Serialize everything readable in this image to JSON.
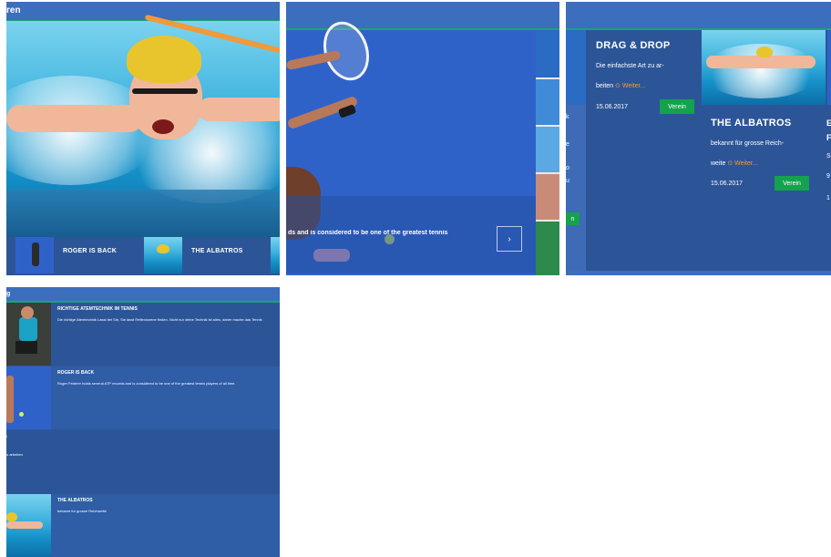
{
  "panel1": {
    "topbar_label": "ren",
    "strip": [
      {
        "label": "ROGER IS BACK"
      },
      {
        "label": "THE ALBATROS"
      }
    ]
  },
  "panel2": {
    "caption": "ds and is considered to be one of the greatest tennis",
    "next_icon": "chevron-right-icon"
  },
  "panel3": {
    "edge_letters": [
      "k",
      "e",
      "o",
      "u",
      "n"
    ],
    "edge_button_label": "n",
    "cards": [
      {
        "title": "DRAG & DROP",
        "text_line1": "Die einfachste Art zu ar-",
        "text_line2": "beiten",
        "more": "Weiter...",
        "date": "15.06.2017",
        "button": "Verein"
      },
      {
        "title": "THE ALBATROS",
        "text_line1": "bekannt für grosse Reich-",
        "text_line2": "weite",
        "more": "Weiter...",
        "date": "15.06.2017",
        "button": "Verein"
      }
    ],
    "right_cut": {
      "title": "E",
      "title2": "F",
      "l1": "S",
      "l2": "9",
      "l3": "1"
    }
  },
  "panel4": {
    "topbar_label": "g",
    "rows": [
      {
        "title": "RICHTIGE ATEMTECHNIK IM TENNIS",
        "text": "Die richtige Atemtechnik Lasst bei Sie, Sie lasst Reflexionene finden. Nicht nur deine Technik ist alles, daher mache das Tennis"
      },
      {
        "title": "ROGER IS BACK",
        "text": "Roger Federer holds several ATP records and is considered to be one of the greatest tennis players of all time."
      },
      {
        "title": "",
        "text": ""
      },
      {
        "title": "THE ALBATROS",
        "text": "bekannt fur grosse Reichweite"
      }
    ],
    "side_word_1": "i",
    "side_word_2": "o arbeiten"
  },
  "colors": {
    "bar": "#3b6ebd",
    "panel": "#2c5598",
    "accent_green": "#14a24d",
    "link_orange": "#f39b32",
    "bar_underline": "#1ba37a"
  }
}
